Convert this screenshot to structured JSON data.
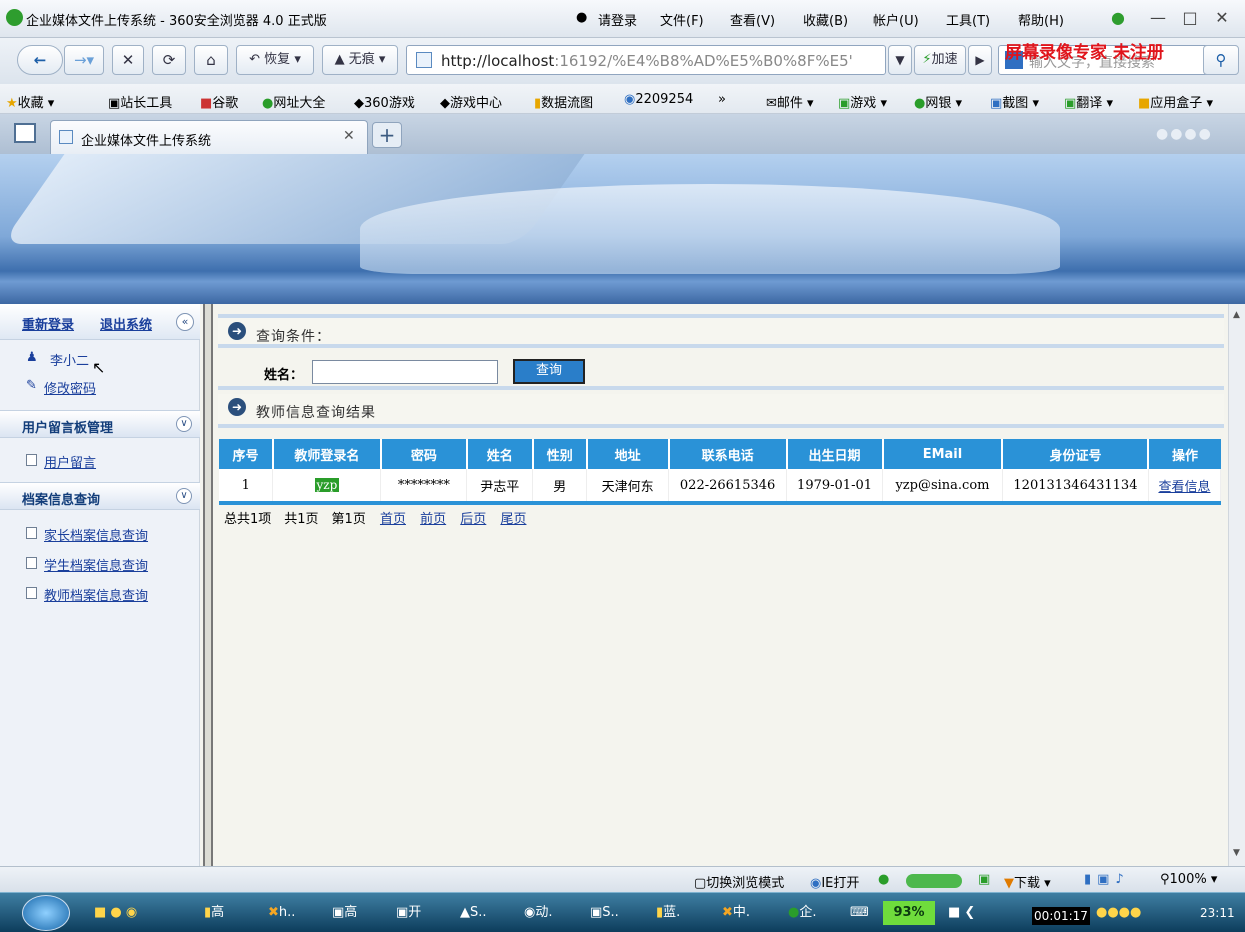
{
  "browser": {
    "window_title": "企业媒体文件上传系统 - 360安全浏览器 4.0 正式版",
    "menu": [
      "请登录",
      "文件(F)",
      "查看(V)",
      "收藏(B)",
      "帐户(U)",
      "工具(T)",
      "帮助(H)"
    ],
    "nav": {
      "restore_label": "恢复",
      "private_label": "无痕",
      "speed_label": "加速"
    },
    "address_host": "http://localhost",
    "address_rest": ":16192/%E4%B8%AD%E5%B0%8F%E5'",
    "search_placeholder": "输入文字，直接搜索",
    "watermark": "屏幕录像专家 未注册",
    "favorites": [
      "收藏",
      "站长工具",
      "谷歌",
      "网址大全",
      "360游戏",
      "游戏中心",
      "数据流图",
      "2209254",
      "»",
      "邮件",
      "游戏",
      "网银",
      "截图",
      "翻译",
      "应用盒子"
    ],
    "tab_title": "企业媒体文件上传系统"
  },
  "sidebar": {
    "relogin": "重新登录",
    "logout": "退出系统",
    "user_name": "李小二",
    "change_password": "修改密码",
    "section1": "用户留言板管理",
    "section1_items": [
      "用户留言"
    ],
    "section2": "档案信息查询",
    "section2_items": [
      "家长档案信息查询",
      "学生档案信息查询",
      "教师档案信息查询"
    ]
  },
  "query": {
    "section_title": "查询条件：",
    "name_label": "姓名：",
    "name_value": "",
    "button": "查询"
  },
  "results": {
    "section_title": "教师信息查询结果",
    "columns": [
      "序号",
      "教师登录名",
      "密码",
      "姓名",
      "性别",
      "地址",
      "联系电话",
      "出生日期",
      "EMail",
      "身份证号",
      "操作"
    ],
    "rows": [
      [
        "1",
        "yzp",
        "********",
        "尹志平",
        "男",
        "天津何东",
        "022-26615346",
        "1979-01-01",
        "yzp@sina.com",
        "120131346431134",
        "查看信息"
      ]
    ],
    "pager": {
      "summary": "总共1项　共1页　第1页",
      "first": "首页",
      "prev": "前页",
      "next": "后页",
      "last": "尾页"
    }
  },
  "statusbar": {
    "switch_mode": "切换浏览模式",
    "ie_open": "IE打开",
    "download": "下载",
    "zoom": "100%"
  },
  "taskbar": {
    "items": [
      "高",
      "h..",
      "高",
      "开",
      "S..",
      "动.",
      "S..",
      "蓝.",
      "中.",
      "企."
    ],
    "battery": "93%",
    "recording_time": "00:01:17",
    "clock": "23:11"
  },
  "colors": {
    "header_blue": "#2a92d7",
    "link_blue": "#1a3f9c",
    "query_button": "#2a7ec9"
  }
}
